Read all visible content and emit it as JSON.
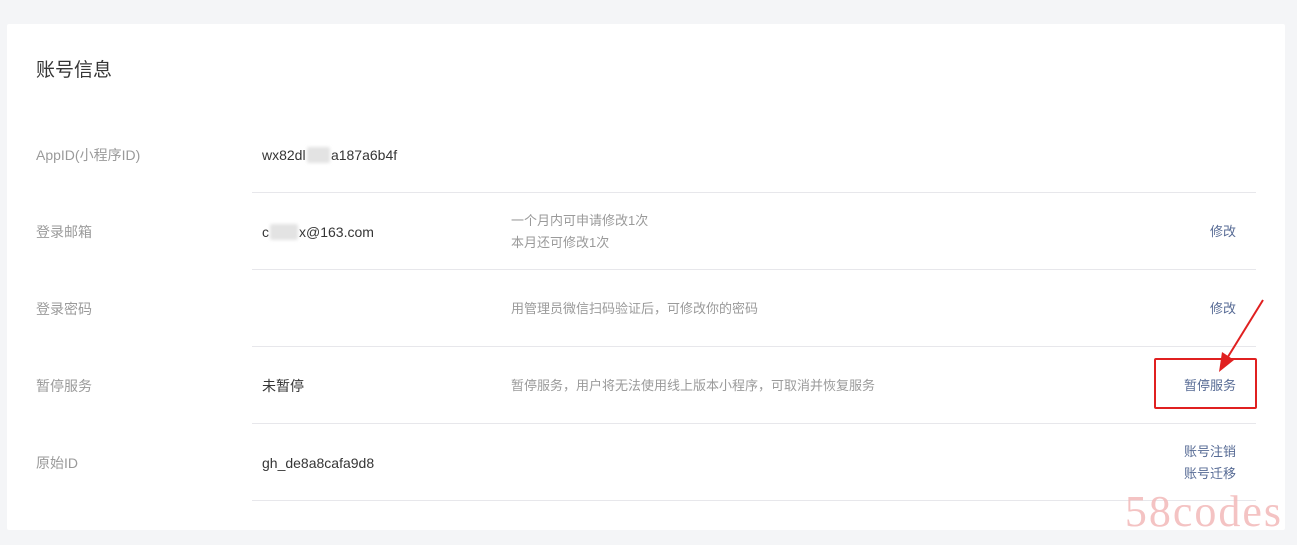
{
  "section": {
    "title": "账号信息"
  },
  "rows": [
    {
      "label": "AppID(小程序ID)",
      "value_prefix": "wx82dl",
      "value_suffix": "a187a6b4f",
      "desc": [],
      "actions": []
    },
    {
      "label": "登录邮箱",
      "value_prefix": "c",
      "value_suffix": "x@163.com",
      "desc": [
        "一个月内可申请修改1次",
        "本月还可修改1次"
      ],
      "actions": [
        "修改"
      ]
    },
    {
      "label": "登录密码",
      "value_prefix": "",
      "value_suffix": "",
      "desc": [
        "用管理员微信扫码验证后，可修改你的密码"
      ],
      "actions": [
        "修改"
      ]
    },
    {
      "label": "暂停服务",
      "value_prefix": "未暂停",
      "value_suffix": "",
      "desc": [
        "暂停服务，用户将无法使用线上版本小程序，可取消并恢复服务"
      ],
      "actions": [
        "暂停服务"
      ]
    },
    {
      "label": "原始ID",
      "value_prefix": "gh_de8a8cafa9d8",
      "value_suffix": "",
      "desc": [],
      "actions": [
        "账号注销",
        "账号迁移"
      ]
    }
  ],
  "watermark": "58codes",
  "colors": {
    "link": "#576b95",
    "highlight": "#e02020",
    "label": "#9a9a9a",
    "text": "#353535"
  }
}
